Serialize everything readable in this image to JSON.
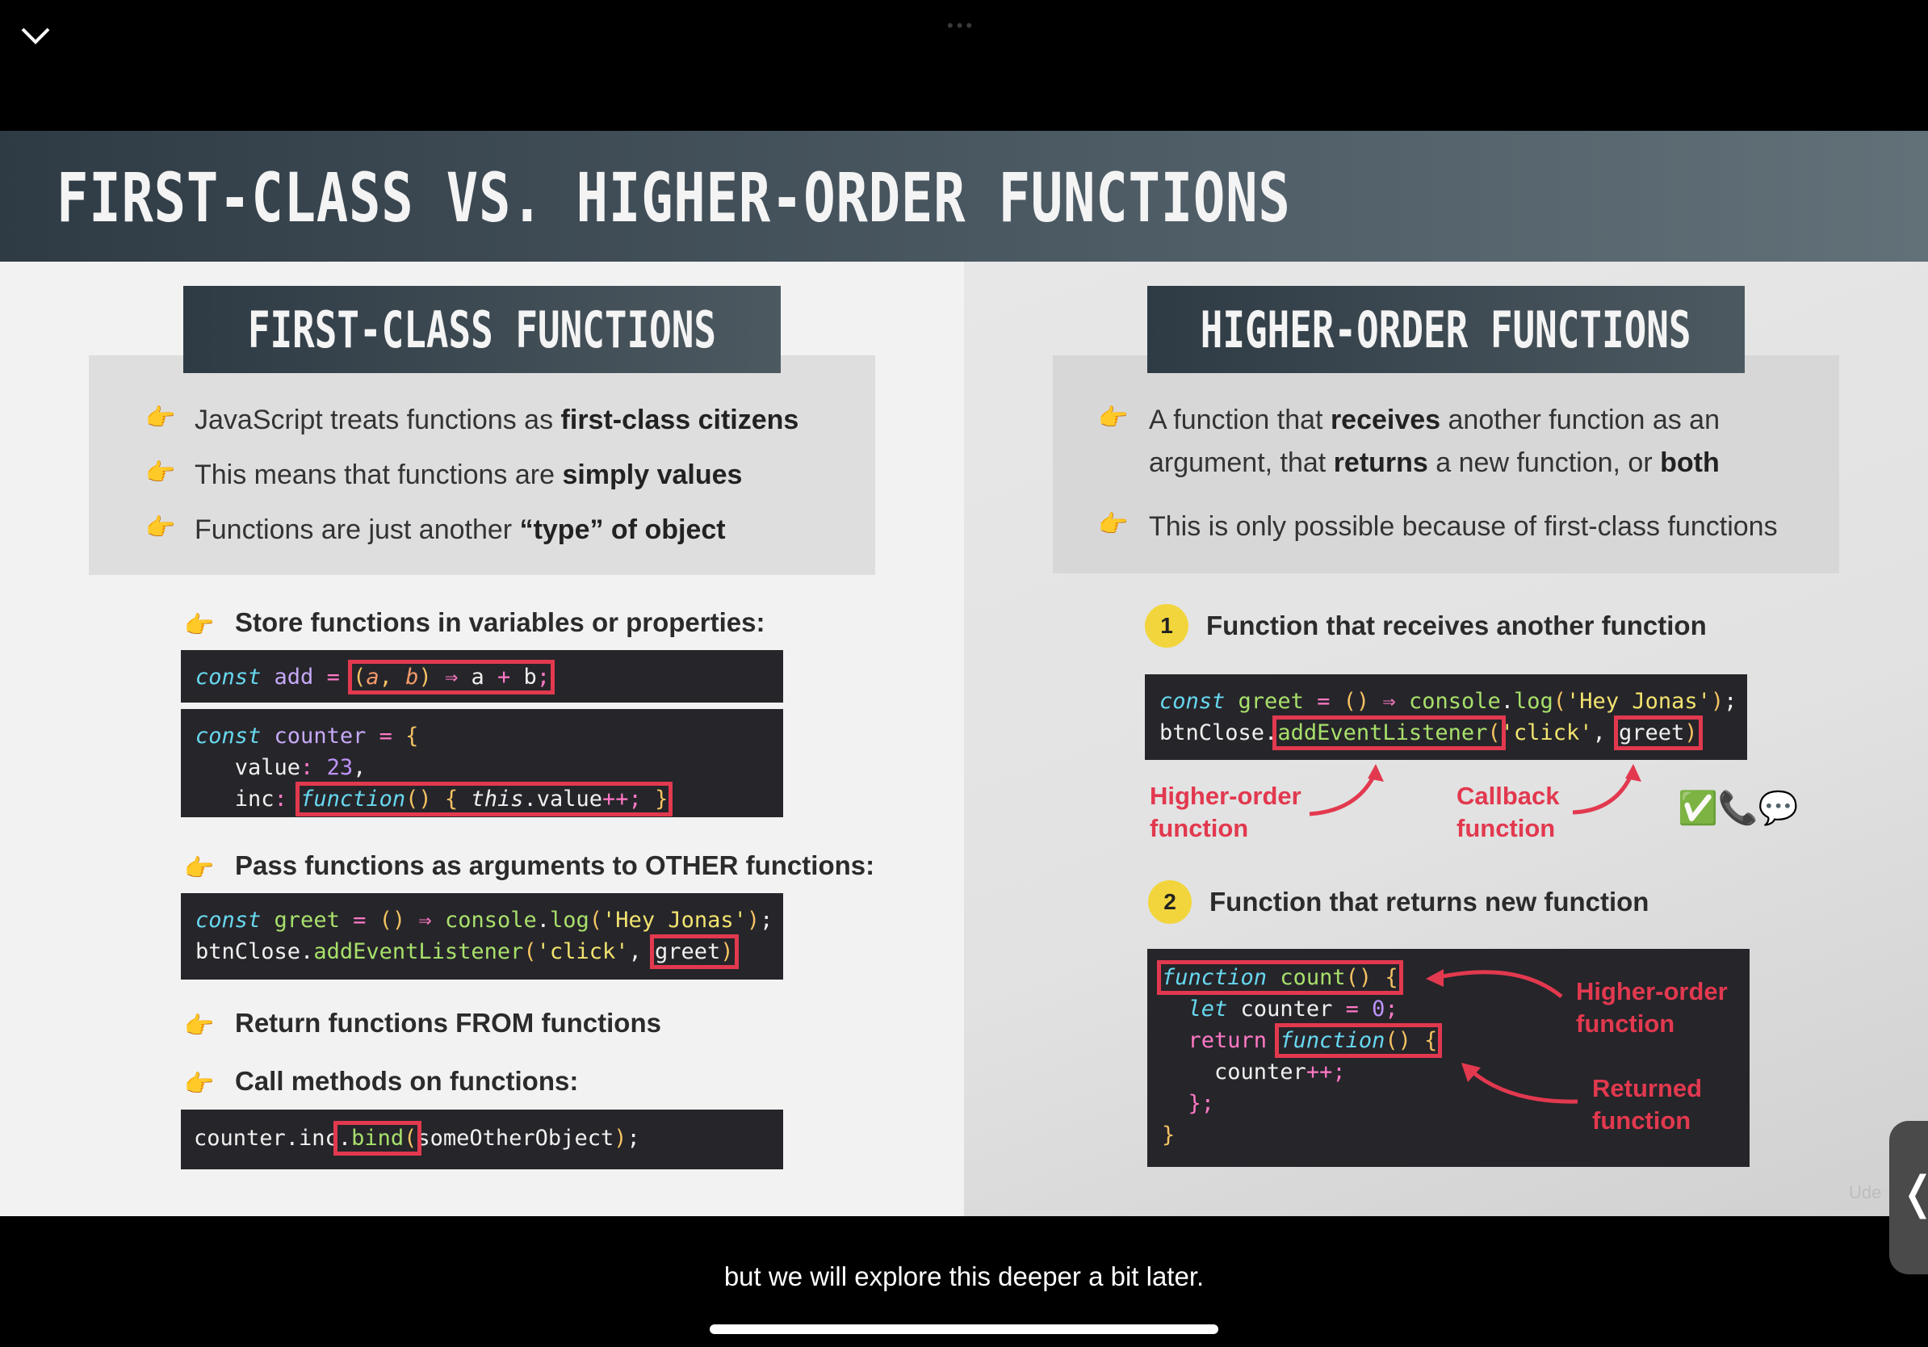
{
  "overlay": {
    "collapse_icon": "chevron-down-icon",
    "caption": "but we will explore this deeper a bit later.",
    "side_tab_icon": "chevron-left-icon",
    "watermark": "Ude"
  },
  "slide": {
    "title": "FIRST-CLASS VS. HIGHER-ORDER FUNCTIONS",
    "left": {
      "heading": "FIRST-CLASS FUNCTIONS",
      "bullets": [
        {
          "text": "JavaScript treats functions as ",
          "bold": "first-class citizens"
        },
        {
          "text": "This means that functions are ",
          "bold": "simply values"
        },
        {
          "text": "Functions are just another ",
          "bold": "“type” of object"
        }
      ],
      "sub_store": "Store functions in variables or properties:",
      "sub_pass": "Pass functions as arguments to OTHER functions:",
      "sub_return": "Return functions FROM functions",
      "sub_call": "Call methods on functions:"
    },
    "right": {
      "heading": "HIGHER-ORDER FUNCTIONS",
      "bullet1_a": "A function that ",
      "bullet1_b": "receives",
      "bullet1_c": " another function as an",
      "bullet1_d": "argument, that ",
      "bullet1_e": "returns",
      "bullet1_f": " a new function, or ",
      "bullet1_g": "both",
      "bullet2": "This is only possible because of first-class functions",
      "item1_num": "1",
      "item1_label": "Function that receives another function",
      "item2_num": "2",
      "item2_label": "Function that returns new function",
      "note_hof_1": "Higher-order",
      "note_hof_2": "function",
      "note_cb_1": "Callback",
      "note_cb_2": "function",
      "note_hof2_1": "Higher-order",
      "note_hof2_2": "function",
      "note_ret_1": "Returned",
      "note_ret_2": "function",
      "emoji": "✅📞💬"
    }
  }
}
